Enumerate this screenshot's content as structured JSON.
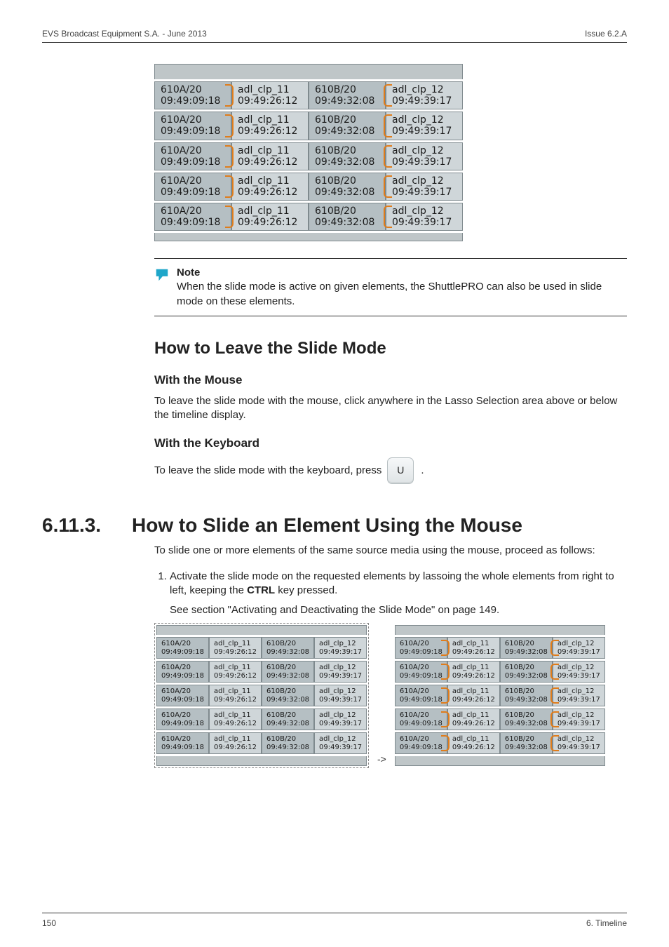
{
  "header": {
    "left": "EVS Broadcast Equipment S.A. - June 2013",
    "right": "Issue 6.2.A"
  },
  "figure_top": {
    "rows": [
      {
        "c1_l1": "610A/20",
        "c1_l2": "09:49:09:18",
        "c2_l1": "adl_clp_11",
        "c2_l2": "09:49:26:12",
        "c3_l1": "610B/20",
        "c3_l2": "09:49:32:08",
        "c4_l1": "adl_clp_12",
        "c4_l2": "09:49:39:17"
      },
      {
        "c1_l1": "610A/20",
        "c1_l2": "09:49:09:18",
        "c2_l1": "adl_clp_11",
        "c2_l2": "09:49:26:12",
        "c3_l1": "610B/20",
        "c3_l2": "09:49:32:08",
        "c4_l1": "adl_clp_12",
        "c4_l2": "09:49:39:17"
      },
      {
        "c1_l1": "610A/20",
        "c1_l2": "09:49:09:18",
        "c2_l1": "adl_clp_11",
        "c2_l2": "09:49:26:12",
        "c3_l1": "610B/20",
        "c3_l2": "09:49:32:08",
        "c4_l1": "adl_clp_12",
        "c4_l2": "09:49:39:17"
      },
      {
        "c1_l1": "610A/20",
        "c1_l2": "09:49:09:18",
        "c2_l1": "adl_clp_11",
        "c2_l2": "09:49:26:12",
        "c3_l1": "610B/20",
        "c3_l2": "09:49:32:08",
        "c4_l1": "adl_clp_12",
        "c4_l2": "09:49:39:17"
      },
      {
        "c1_l1": "610A/20",
        "c1_l2": "09:49:09:18",
        "c2_l1": "adl_clp_11",
        "c2_l2": "09:49:26:12",
        "c3_l1": "610B/20",
        "c3_l2": "09:49:32:08",
        "c4_l1": "adl_clp_12",
        "c4_l2": "09:49:39:17"
      }
    ]
  },
  "note": {
    "title": "Note",
    "text": "When the slide mode is active on given elements, the ShuttlePRO can also be used in slide mode on these elements."
  },
  "section1": {
    "title": "How to Leave the Slide Mode",
    "mouse_h": "With the Mouse",
    "mouse_p": "To leave the slide mode with the mouse, click anywhere in the Lasso Selection area above or below the timeline display.",
    "kbd_h": "With the Keyboard",
    "kbd_p_pre": "To leave the slide mode with the keyboard, press",
    "kbd_key": "U",
    "kbd_p_post": "."
  },
  "section2": {
    "num": "6.11.3.",
    "title": "How to Slide an Element Using the Mouse",
    "intro": "To slide one or more elements of the same source media using the mouse, proceed as follows:",
    "step1_a": "Activate the slide mode on the requested elements by lassoing the whole elements from right to left, keeping the ",
    "step1_b": "CTRL",
    "step1_c": " key pressed.",
    "step1_ref": "See section \"Activating and Deactivating the Slide Mode\" on page 149."
  },
  "figure_small": {
    "rows": [
      {
        "c1_l1": "610A/20",
        "c1_l2": "09:49:09:18",
        "c2_l1": "adl_clp_11",
        "c2_l2": "09:49:26:12",
        "c3_l1": "610B/20",
        "c3_l2": "09:49:32:08",
        "c4_l1": "adl_clp_12",
        "c4_l2": "09:49:39:17"
      },
      {
        "c1_l1": "610A/20",
        "c1_l2": "09:49:09:18",
        "c2_l1": "adl_clp_11",
        "c2_l2": "09:49:26:12",
        "c3_l1": "610B/20",
        "c3_l2": "09:49:32:08",
        "c4_l1": "adl_clp_12",
        "c4_l2": "09:49:39:17"
      },
      {
        "c1_l1": "610A/20",
        "c1_l2": "09:49:09:18",
        "c2_l1": "adl_clp_11",
        "c2_l2": "09:49:26:12",
        "c3_l1": "610B/20",
        "c3_l2": "09:49:32:08",
        "c4_l1": "adl_clp_12",
        "c4_l2": "09:49:39:17"
      },
      {
        "c1_l1": "610A/20",
        "c1_l2": "09:49:09:18",
        "c2_l1": "adl_clp_11",
        "c2_l2": "09:49:26:12",
        "c3_l1": "610B/20",
        "c3_l2": "09:49:32:08",
        "c4_l1": "adl_clp_12",
        "c4_l2": "09:49:39:17"
      },
      {
        "c1_l1": "610A/20",
        "c1_l2": "09:49:09:18",
        "c2_l1": "adl_clp_11",
        "c2_l2": "09:49:26:12",
        "c3_l1": "610B/20",
        "c3_l2": "09:49:32:08",
        "c4_l1": "adl_clp_12",
        "c4_l2": "09:49:39:17"
      }
    ],
    "arrow": "->"
  },
  "footer": {
    "left": "150",
    "right": "6. Timeline"
  }
}
